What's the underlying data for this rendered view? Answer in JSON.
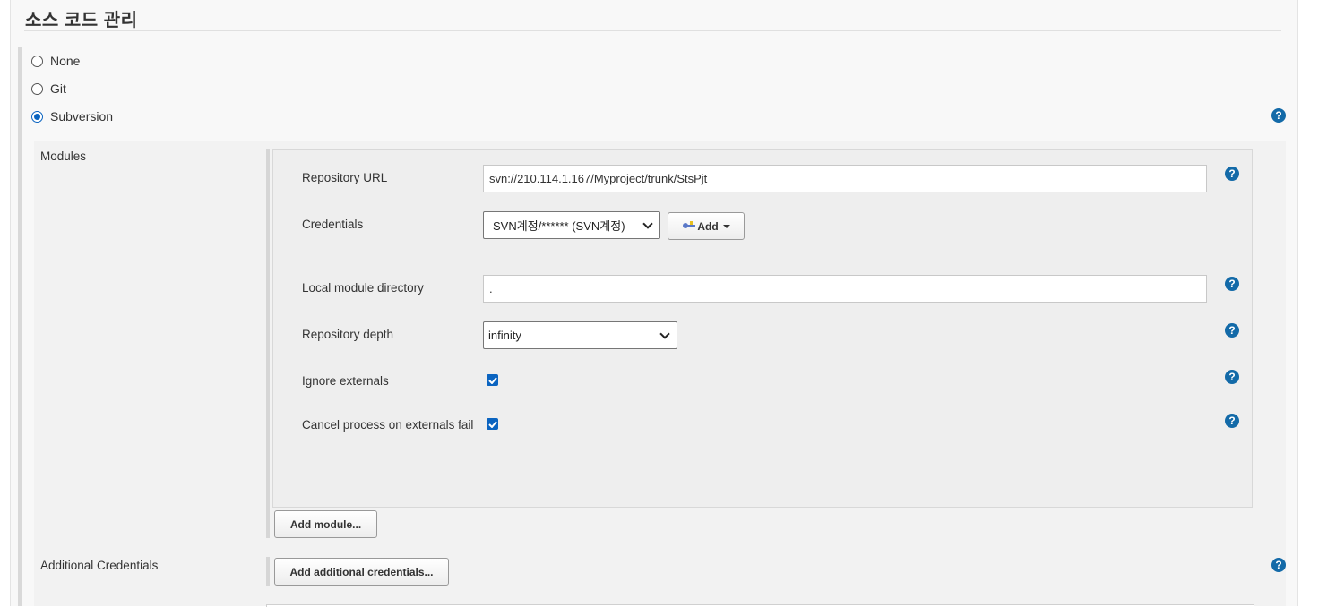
{
  "section": {
    "title": "소스 코드 관리"
  },
  "scm_options": [
    {
      "label": "None",
      "selected": false
    },
    {
      "label": "Git",
      "selected": false
    },
    {
      "label": "Subversion",
      "selected": true
    }
  ],
  "modules": {
    "label": "Modules",
    "repository_url": {
      "label": "Repository URL",
      "value": "svn://210.114.1.167/Myproject/trunk/StsPjt"
    },
    "credentials": {
      "label": "Credentials",
      "selected": "SVN계정/****** (SVN계정)",
      "add_label": "Add"
    },
    "local_module_directory": {
      "label": "Local module directory",
      "value": "."
    },
    "repository_depth": {
      "label": "Repository depth",
      "selected": "infinity"
    },
    "ignore_externals": {
      "label": "Ignore externals",
      "checked": true
    },
    "cancel_on_externals_fail": {
      "label": "Cancel process on externals fail",
      "checked": true
    },
    "add_module_label": "Add module..."
  },
  "additional_credentials": {
    "label": "Additional Credentials",
    "button_label": "Add additional credentials..."
  },
  "help_glyph": "?",
  "icons": {
    "help": "help-icon",
    "key": "key-icon",
    "dropdown": "chevron-down-icon"
  },
  "colors": {
    "accent": "#0b64c0",
    "help": "#136aa8"
  }
}
